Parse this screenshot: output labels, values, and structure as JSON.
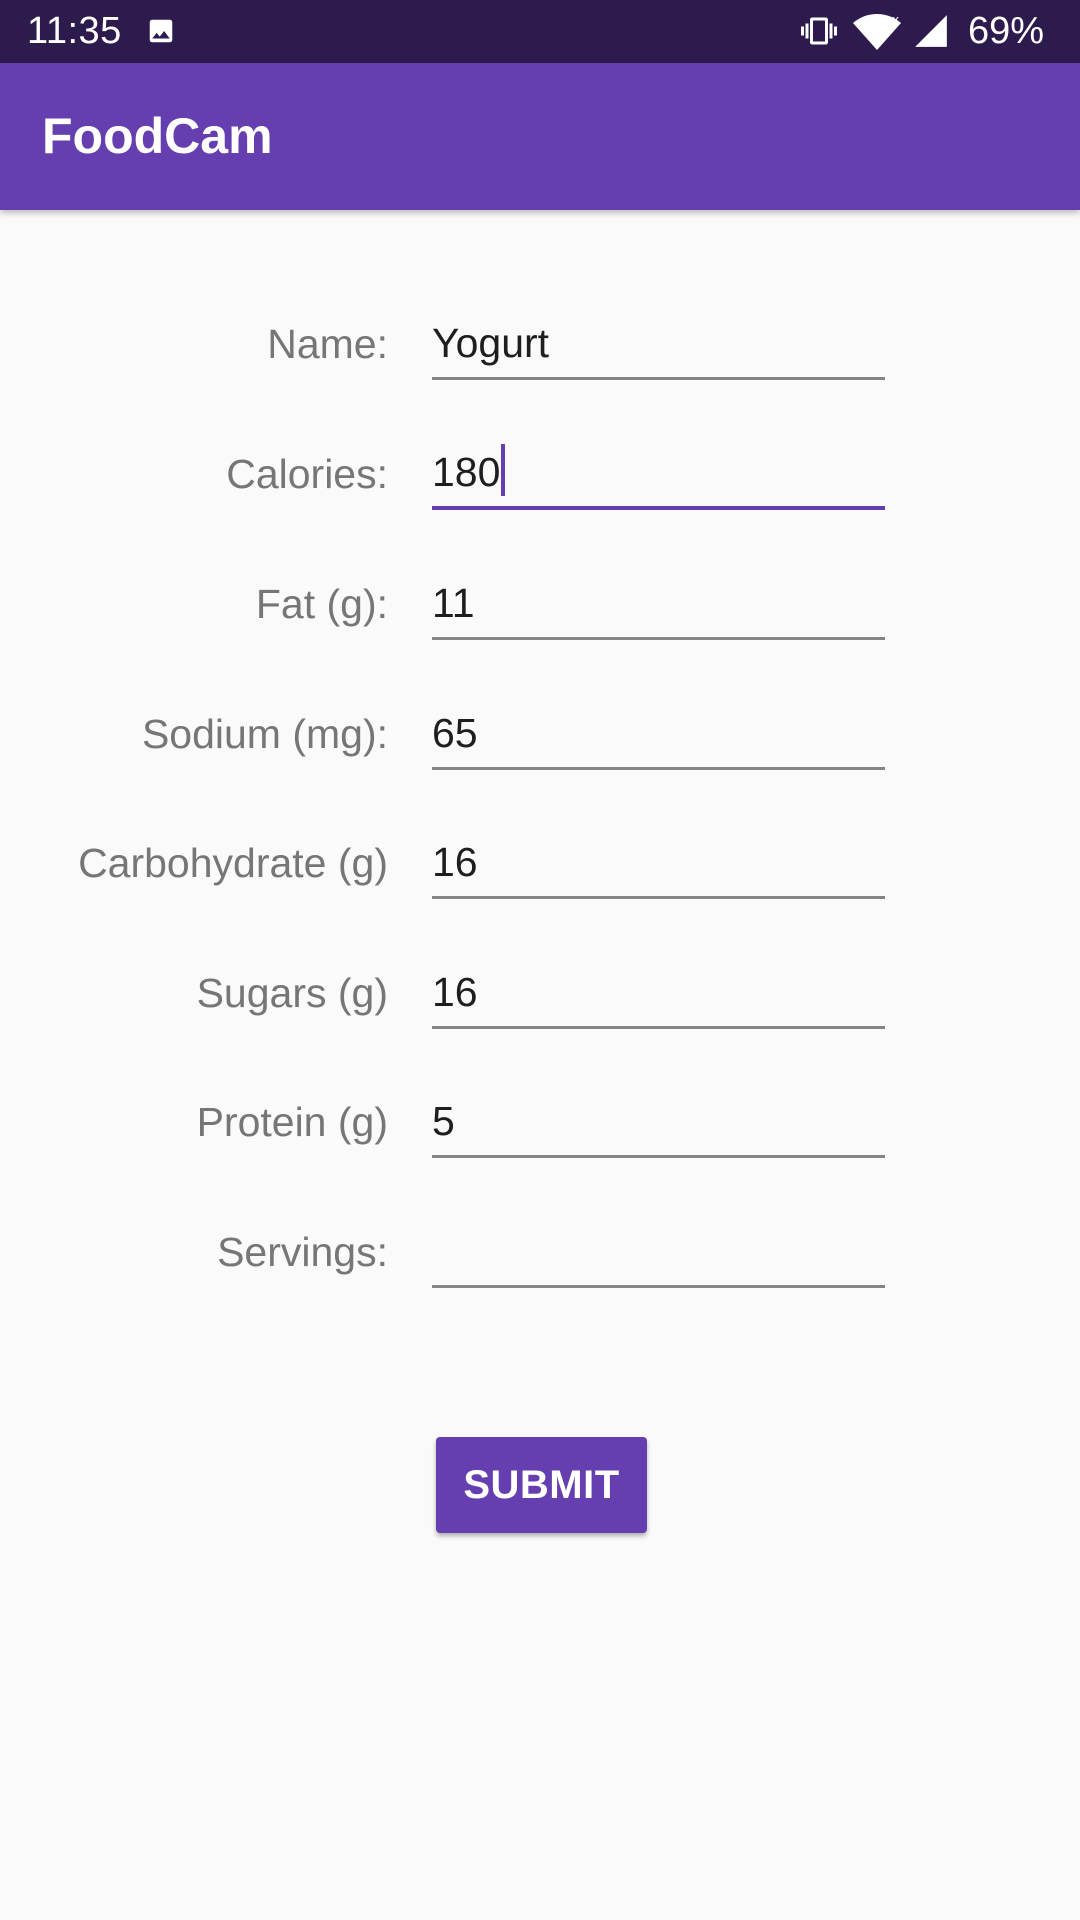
{
  "status_bar": {
    "time": "11:35",
    "battery": "69%",
    "icons": [
      "image-icon",
      "vibrate-icon",
      "wifi-icon",
      "signal-icon"
    ]
  },
  "app_bar": {
    "title": "FoodCam"
  },
  "form": {
    "fields": [
      {
        "label": "Name:",
        "value": "Yogurt"
      },
      {
        "label": "Calories:",
        "value": "180"
      },
      {
        "label": "Fat (g):",
        "value": "11"
      },
      {
        "label": "Sodium (mg):",
        "value": "65"
      },
      {
        "label": "Carbohydrate (g)",
        "value": "16"
      },
      {
        "label": "Sugars (g)",
        "value": "16"
      },
      {
        "label": "Protein (g)",
        "value": "5"
      },
      {
        "label": "Servings:",
        "value": ""
      }
    ],
    "submit_label": "SUBMIT"
  },
  "colors": {
    "status_bar": "#2d1b4e",
    "primary": "#653fb0",
    "background": "#fafafa",
    "label_text": "#767676",
    "value_text": "#1e1e1e"
  }
}
